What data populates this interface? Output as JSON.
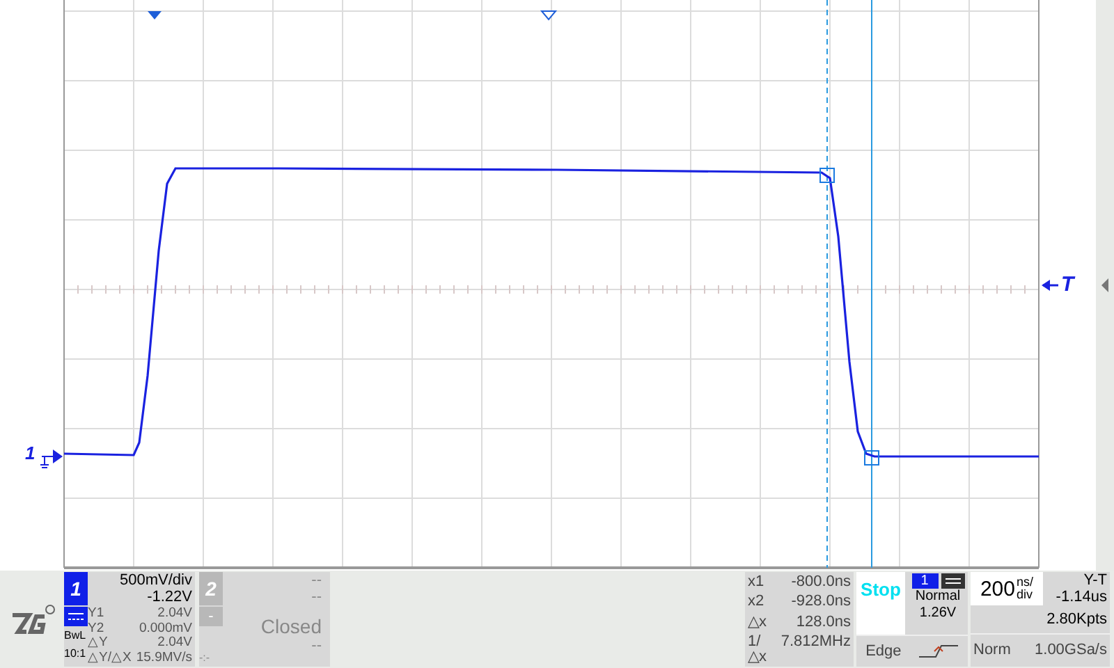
{
  "plot": {
    "channel_marker": "1",
    "trigger_marker": "T"
  },
  "channel1": {
    "number": "1",
    "scale": "500mV/div",
    "offset": "-1.22V",
    "coupling_label": "BwL",
    "probe": "10:1",
    "readings": [
      {
        "label": "Y1",
        "value": "2.04V"
      },
      {
        "label": "Y2",
        "value": "0.000mV"
      },
      {
        "label": "△Y",
        "value": "2.04V"
      },
      {
        "label": "△Y/△X",
        "value": "15.9MV/s"
      }
    ]
  },
  "channel2": {
    "number": "2",
    "scale": "--",
    "offset": "--",
    "minus": "-",
    "status": "Closed",
    "value": "--",
    "extra": "-:-"
  },
  "cursors": [
    {
      "label": "x1",
      "value": "-800.0ns"
    },
    {
      "label": "x2",
      "value": "-928.0ns"
    },
    {
      "label": "△x",
      "value": "128.0ns"
    },
    {
      "label": "1/△x",
      "value": "7.812MHz"
    }
  ],
  "run": {
    "state": "Stop"
  },
  "trigger": {
    "source": "1",
    "mode": "Normal",
    "level": "1.26V",
    "type": "Edge"
  },
  "timebase": {
    "value": "200",
    "unit_top": "ns/",
    "unit_bottom": "div",
    "mode": "Y-T",
    "delay": "-1.14us",
    "memory": "2.80Kpts",
    "acquisition": "Norm",
    "rate": "1.00GSa/s"
  }
}
